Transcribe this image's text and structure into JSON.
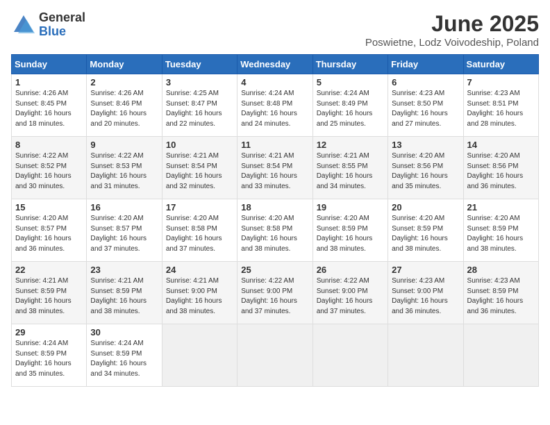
{
  "header": {
    "logo_general": "General",
    "logo_blue": "Blue",
    "title": "June 2025",
    "subtitle": "Poswietne, Lodz Voivodeship, Poland"
  },
  "weekdays": [
    "Sunday",
    "Monday",
    "Tuesday",
    "Wednesday",
    "Thursday",
    "Friday",
    "Saturday"
  ],
  "weeks": [
    [
      {
        "day": "1",
        "info": "Sunrise: 4:26 AM\nSunset: 8:45 PM\nDaylight: 16 hours\nand 18 minutes."
      },
      {
        "day": "2",
        "info": "Sunrise: 4:26 AM\nSunset: 8:46 PM\nDaylight: 16 hours\nand 20 minutes."
      },
      {
        "day": "3",
        "info": "Sunrise: 4:25 AM\nSunset: 8:47 PM\nDaylight: 16 hours\nand 22 minutes."
      },
      {
        "day": "4",
        "info": "Sunrise: 4:24 AM\nSunset: 8:48 PM\nDaylight: 16 hours\nand 24 minutes."
      },
      {
        "day": "5",
        "info": "Sunrise: 4:24 AM\nSunset: 8:49 PM\nDaylight: 16 hours\nand 25 minutes."
      },
      {
        "day": "6",
        "info": "Sunrise: 4:23 AM\nSunset: 8:50 PM\nDaylight: 16 hours\nand 27 minutes."
      },
      {
        "day": "7",
        "info": "Sunrise: 4:23 AM\nSunset: 8:51 PM\nDaylight: 16 hours\nand 28 minutes."
      }
    ],
    [
      {
        "day": "8",
        "info": "Sunrise: 4:22 AM\nSunset: 8:52 PM\nDaylight: 16 hours\nand 30 minutes."
      },
      {
        "day": "9",
        "info": "Sunrise: 4:22 AM\nSunset: 8:53 PM\nDaylight: 16 hours\nand 31 minutes."
      },
      {
        "day": "10",
        "info": "Sunrise: 4:21 AM\nSunset: 8:54 PM\nDaylight: 16 hours\nand 32 minutes."
      },
      {
        "day": "11",
        "info": "Sunrise: 4:21 AM\nSunset: 8:54 PM\nDaylight: 16 hours\nand 33 minutes."
      },
      {
        "day": "12",
        "info": "Sunrise: 4:21 AM\nSunset: 8:55 PM\nDaylight: 16 hours\nand 34 minutes."
      },
      {
        "day": "13",
        "info": "Sunrise: 4:20 AM\nSunset: 8:56 PM\nDaylight: 16 hours\nand 35 minutes."
      },
      {
        "day": "14",
        "info": "Sunrise: 4:20 AM\nSunset: 8:56 PM\nDaylight: 16 hours\nand 36 minutes."
      }
    ],
    [
      {
        "day": "15",
        "info": "Sunrise: 4:20 AM\nSunset: 8:57 PM\nDaylight: 16 hours\nand 36 minutes."
      },
      {
        "day": "16",
        "info": "Sunrise: 4:20 AM\nSunset: 8:57 PM\nDaylight: 16 hours\nand 37 minutes."
      },
      {
        "day": "17",
        "info": "Sunrise: 4:20 AM\nSunset: 8:58 PM\nDaylight: 16 hours\nand 37 minutes."
      },
      {
        "day": "18",
        "info": "Sunrise: 4:20 AM\nSunset: 8:58 PM\nDaylight: 16 hours\nand 38 minutes."
      },
      {
        "day": "19",
        "info": "Sunrise: 4:20 AM\nSunset: 8:59 PM\nDaylight: 16 hours\nand 38 minutes."
      },
      {
        "day": "20",
        "info": "Sunrise: 4:20 AM\nSunset: 8:59 PM\nDaylight: 16 hours\nand 38 minutes."
      },
      {
        "day": "21",
        "info": "Sunrise: 4:20 AM\nSunset: 8:59 PM\nDaylight: 16 hours\nand 38 minutes."
      }
    ],
    [
      {
        "day": "22",
        "info": "Sunrise: 4:21 AM\nSunset: 8:59 PM\nDaylight: 16 hours\nand 38 minutes."
      },
      {
        "day": "23",
        "info": "Sunrise: 4:21 AM\nSunset: 8:59 PM\nDaylight: 16 hours\nand 38 minutes."
      },
      {
        "day": "24",
        "info": "Sunrise: 4:21 AM\nSunset: 9:00 PM\nDaylight: 16 hours\nand 38 minutes."
      },
      {
        "day": "25",
        "info": "Sunrise: 4:22 AM\nSunset: 9:00 PM\nDaylight: 16 hours\nand 37 minutes."
      },
      {
        "day": "26",
        "info": "Sunrise: 4:22 AM\nSunset: 9:00 PM\nDaylight: 16 hours\nand 37 minutes."
      },
      {
        "day": "27",
        "info": "Sunrise: 4:23 AM\nSunset: 9:00 PM\nDaylight: 16 hours\nand 36 minutes."
      },
      {
        "day": "28",
        "info": "Sunrise: 4:23 AM\nSunset: 8:59 PM\nDaylight: 16 hours\nand 36 minutes."
      }
    ],
    [
      {
        "day": "29",
        "info": "Sunrise: 4:24 AM\nSunset: 8:59 PM\nDaylight: 16 hours\nand 35 minutes."
      },
      {
        "day": "30",
        "info": "Sunrise: 4:24 AM\nSunset: 8:59 PM\nDaylight: 16 hours\nand 34 minutes."
      },
      {
        "day": "",
        "info": ""
      },
      {
        "day": "",
        "info": ""
      },
      {
        "day": "",
        "info": ""
      },
      {
        "day": "",
        "info": ""
      },
      {
        "day": "",
        "info": ""
      }
    ]
  ]
}
